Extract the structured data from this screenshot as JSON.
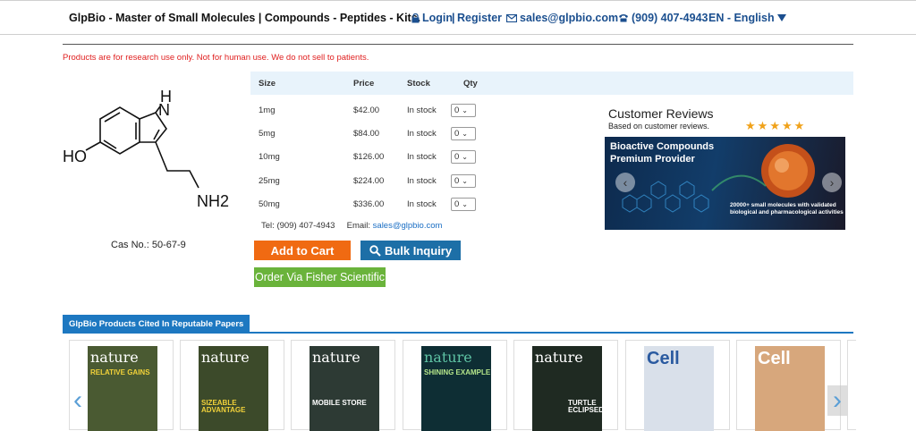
{
  "header": {
    "brand": "GlpBio - Master of Small Molecules | Compounds - Peptides - Kits.",
    "login": "Login",
    "separator": "|",
    "register": "Register",
    "email": "sales@glpbio.com",
    "phone": "(909) 407-4943",
    "language": "EN - English"
  },
  "disclaimer": "Products are for research use only. Not for human use. We do not sell to patients.",
  "molecule": {
    "ho_label": "HO",
    "nh_label": "H",
    "n_label": "N",
    "nh2_label": "NH2"
  },
  "cas": "Cas No.: 50-67-9",
  "table": {
    "headers": {
      "size": "Size",
      "price": "Price",
      "stock": "Stock",
      "qty": "Qty"
    },
    "rows": [
      {
        "size": "1mg",
        "price": "$42.00",
        "stock": "In stock",
        "qty": "0"
      },
      {
        "size": "5mg",
        "price": "$84.00",
        "stock": "In stock",
        "qty": "0"
      },
      {
        "size": "10mg",
        "price": "$126.00",
        "stock": "In stock",
        "qty": "0"
      },
      {
        "size": "25mg",
        "price": "$224.00",
        "stock": "In stock",
        "qty": "0"
      },
      {
        "size": "50mg",
        "price": "$336.00",
        "stock": "In stock",
        "qty": "0"
      }
    ]
  },
  "contact": {
    "tel_label": "Tel:",
    "tel": "(909) 407-4943",
    "email_label": "Email:",
    "email": "sales@glpbio.com"
  },
  "buttons": {
    "add_to_cart": "Add to Cart",
    "bulk_inquiry": "Bulk Inquiry",
    "fisher": "Order Via Fisher Scientific"
  },
  "reviews": {
    "title": "Customer Reviews",
    "subtitle": "Based on customer reviews.",
    "stars": 5
  },
  "banner": {
    "line1": "Bioactive Compounds",
    "line2": "Premium Provider",
    "caption": "20000+ small molecules with validated biological and pharmacological activities"
  },
  "cited": {
    "tab": "GlpBio Products Cited In Reputable Papers",
    "papers": [
      {
        "title": "nature",
        "sub": "RELATIVE GAINS",
        "color": "#4a5a32"
      },
      {
        "title": "nature",
        "sub": "SIZEABLE ADVANTAGE",
        "color": "#3c4a2a"
      },
      {
        "title": "nature",
        "sub": "MOBILE STORE",
        "color": "#2d3a34"
      },
      {
        "title": "nature",
        "sub": "SHINING EXAMPLE",
        "color": "#0e2e34"
      },
      {
        "title": "nature",
        "sub": "TURTLE ECLIPSED",
        "color": "#1f2a22"
      },
      {
        "title": "Cell",
        "sub": "",
        "color": "#d9e0ea"
      },
      {
        "title": "Cell",
        "sub": "",
        "color": "#d7a77c"
      }
    ]
  },
  "colors": {
    "brand_blue": "#1b4f8f",
    "cart_orange": "#f06a12",
    "bulk_blue": "#1d6fa7",
    "fisher_green": "#6ab33b",
    "accent_blue": "#1d78c1",
    "red": "#e02020"
  }
}
